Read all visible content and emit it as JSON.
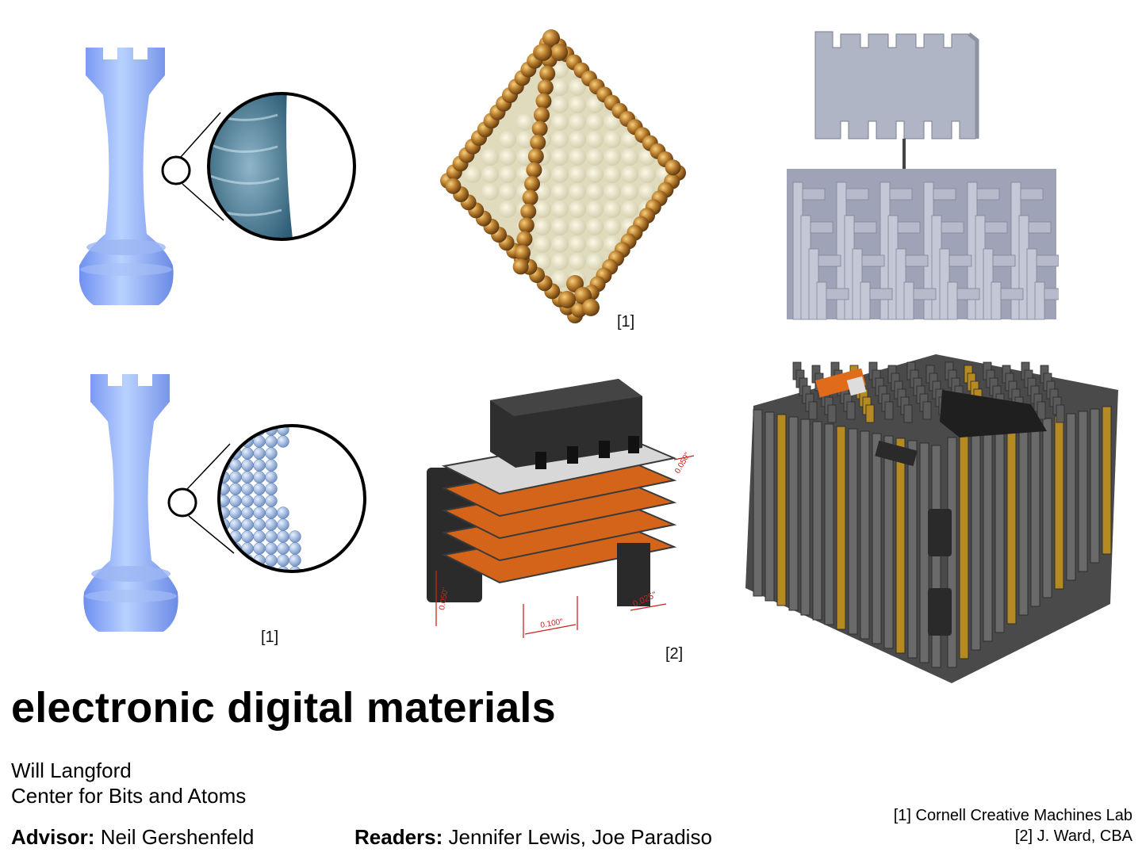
{
  "title": "electronic digital materials",
  "author": {
    "name": "Will Langford",
    "affiliation": "Center for Bits and Atoms"
  },
  "advisor": {
    "label": "Advisor:",
    "name": "Neil Gershenfeld"
  },
  "readers": {
    "label": "Readers:",
    "names": "Jennifer Lewis, Joe Paradiso"
  },
  "citations": {
    "top_middle": "[1]",
    "bottom_left": "[1]",
    "bottom_middle": "[2]"
  },
  "dimensions": {
    "d1": "0.050\"",
    "d2": "0.100\"",
    "d3": "0.025\"",
    "d4": "0.050\""
  },
  "references": [
    "[1] Cornell Creative Machines Lab",
    "[2] J. Ward, CBA"
  ],
  "colors": {
    "rook": "#8aaef0",
    "gold": "#b87a2a",
    "pearl": "#e8e3c8",
    "grey_part": "#a9adbd",
    "orange": "#d4641a",
    "dark_part": "#555555",
    "dim_red": "#cc2222"
  }
}
